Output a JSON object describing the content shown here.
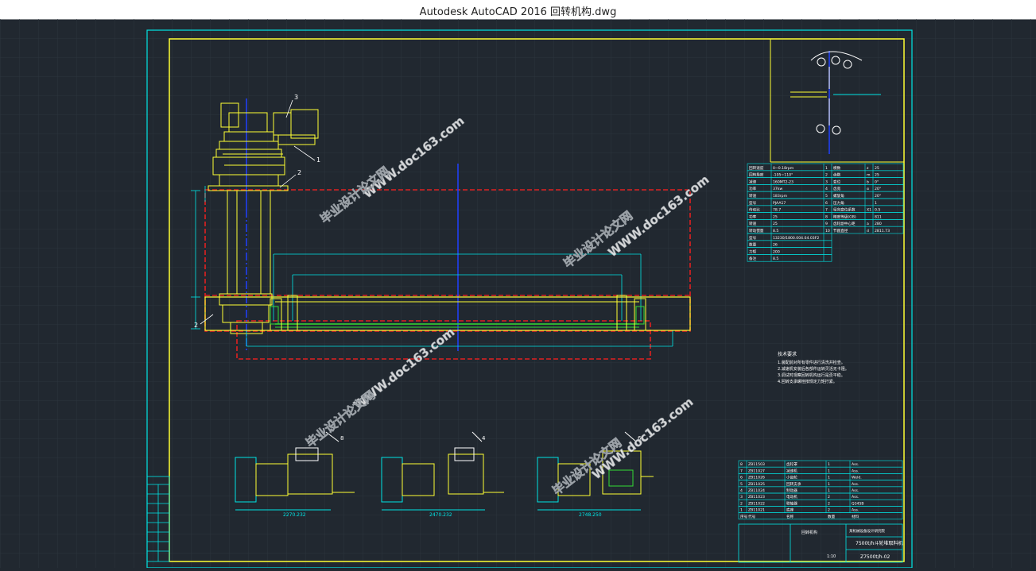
{
  "window": {
    "title": "Autodesk AutoCAD 2016     回转机构.dwg"
  },
  "drawing": {
    "callouts": [
      "3",
      "1",
      "2",
      "2",
      "8",
      "4",
      "6"
    ],
    "notes_title": "技术要求",
    "notes": [
      "1.装配前对所有零件进行清洗并检查。",
      "2.减速机安装后各部件运转灵活无卡阻。",
      "3.调试时观察回转机构运行是否平稳。",
      "4.回转支承螺栓按规定力矩拧紧。"
    ],
    "section_dims": [
      "2270.232",
      "2470.232",
      "2748.250"
    ],
    "watermarks": [
      "WWW.doc163.com",
      "毕业设计论文网",
      "WWW.doc163.com",
      "毕业设计论文网",
      "WWW.doc163.com",
      "毕业设计论文网",
      "WWW.doc163.com",
      "毕业设计论文网"
    ],
    "params_table": {
      "rows": [
        [
          "回转速度",
          "0~0.18rpm",
          "1",
          "模数",
          "z",
          "25"
        ],
        [
          "回转角度",
          "-105~110°",
          "2",
          "齿数",
          "m",
          "25"
        ],
        [
          "减速",
          "160MT2-23",
          "3",
          "变位",
          "b",
          "0°"
        ],
        [
          "功率",
          "37kw",
          "4",
          "齿宽",
          "α",
          "20°"
        ],
        [
          "转速",
          "183rpm",
          "5",
          "螺旋角",
          "",
          "20°"
        ],
        [
          "型号",
          "PJAA17",
          "6",
          "压力角",
          "",
          "1"
        ],
        [
          "传动比",
          "78.7",
          "7",
          "径向变位系数",
          "X1",
          "0.5"
        ],
        [
          "功率",
          "25",
          "8",
          "精度等级(GB)",
          "",
          "811"
        ],
        [
          "转速",
          "25",
          "9",
          "齿轮副中心距",
          "a",
          "280"
        ],
        [
          "转动惯量",
          "8.5",
          "10",
          "节圆直径",
          "d",
          "2811.73"
        ],
        [
          "型号",
          "13230/1800.004.04.03F2",
          "",
          "",
          "",
          ""
        ],
        [
          "数量",
          "26",
          "",
          "",
          "",
          ""
        ],
        [
          "力矩",
          "200",
          "",
          "",
          "",
          ""
        ],
        [
          "备注",
          "8.5",
          "",
          "",
          "",
          ""
        ]
      ]
    },
    "bom": {
      "rows": [
        [
          "8",
          "ZB11503",
          "齿轮罩",
          "1",
          "Ass."
        ],
        [
          "7",
          "ZB11027",
          "减速机",
          "1",
          "Ass."
        ],
        [
          "6",
          "ZB11026",
          "小齿轮",
          "1",
          "Weld."
        ],
        [
          "5",
          "ZB11025",
          "回转支承",
          "1",
          "Ass."
        ],
        [
          "4",
          "ZB11024",
          "制动器",
          "1",
          "Ass."
        ],
        [
          "3",
          "ZB11023",
          "电动机",
          "2",
          "Ass."
        ],
        [
          "2",
          "ZB11022",
          "联轴器",
          "2",
          "Q345B"
        ],
        [
          "1",
          "ZB11021",
          "底座",
          "2",
          "Ass."
        ]
      ],
      "header": [
        "序号",
        "代号",
        "名称",
        "数量",
        "材料"
      ],
      "project": "回转机构",
      "company": "某机械设备设计研究院",
      "title": "7500t/h斗轮堆取料机",
      "drawing_no": "Z7500t/h-02",
      "scale": "1:10"
    }
  },
  "colors": {
    "background": "#212830",
    "frame_yellow": "#ffff33",
    "frame_cyan": "#00e5e5",
    "red_dashed": "#e02020",
    "green": "#33dd33",
    "blue": "#2040ff",
    "watermark": "#ffffff"
  }
}
